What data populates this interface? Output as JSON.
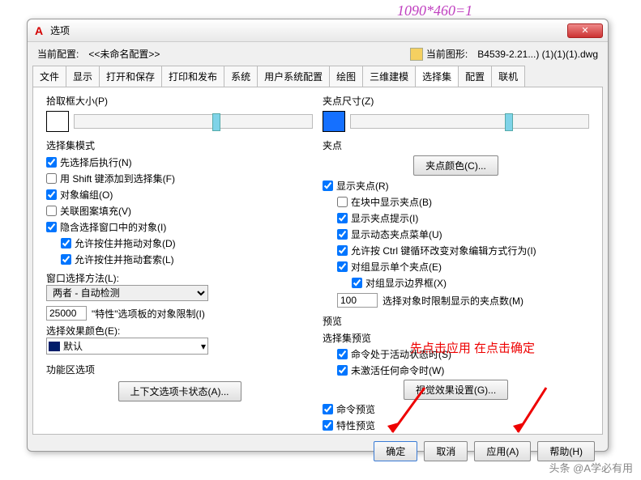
{
  "overlay": "1090*460=1",
  "dialog": {
    "title": "选项"
  },
  "profile": {
    "current_profile_label": "当前配置:",
    "current_profile_value": "<<未命名配置>>",
    "current_drawing_label": "当前图形:",
    "current_drawing_value": "B4539-2.21...) (1)(1)(1).dwg"
  },
  "tabs": [
    "文件",
    "显示",
    "打开和保存",
    "打印和发布",
    "系统",
    "用户系统配置",
    "绘图",
    "三维建模",
    "选择集",
    "配置",
    "联机"
  ],
  "active_tab": "选择集",
  "left": {
    "pickbox_label": "拾取框大小(P)",
    "mode_title": "选择集模式",
    "cb_noun_verb": "先选择后执行(N)",
    "cb_shift_add": "用 Shift 键添加到选择集(F)",
    "cb_object_group": "对象编组(O)",
    "cb_assoc_hatch": "关联图案填充(V)",
    "cb_implied_window": "隐含选择窗口中的对象(I)",
    "cb_allow_press_drag": "允许按住并拖动对象(D)",
    "cb_allow_press_drag_lasso": "允许按住并拖动套索(L)",
    "window_method_label": "窗口选择方法(L):",
    "window_method_value": "两者 - 自动检测",
    "limit_value": "25000",
    "limit_label": "\"特性\"选项板的对象限制(I)",
    "effect_color_label": "选择效果颜色(E):",
    "effect_color_value": "默认",
    "ribbon_title": "功能区选项",
    "ribbon_btn": "上下文选项卡状态(A)..."
  },
  "right": {
    "gripsize_label": "夹点尺寸(Z)",
    "grips_title": "夹点",
    "grip_color_btn": "夹点颜色(C)...",
    "cb_show_grips": "显示夹点(R)",
    "cb_grips_in_blocks": "在块中显示夹点(B)",
    "cb_grip_tips": "显示夹点提示(I)",
    "cb_dynamic_grip_menu": "显示动态夹点菜单(U)",
    "cb_ctrl_cycle": "允许按 Ctrl 键循环改变对象编辑方式行为(I)",
    "cb_group_single": "对组显示单个夹点(E)",
    "cb_group_bbox": "对组显示边界框(X)",
    "grip_limit_value": "100",
    "grip_limit_label": "选择对象时限制显示的夹点数(M)",
    "preview_title": "预览",
    "preview_sub": "选择集预览",
    "cb_active_cmd": "命令处于活动状态时(S)",
    "cb_no_active_cmd": "未激活任何命令时(W)",
    "visual_btn": "视觉效果设置(G)...",
    "cb_cmd_preview": "命令预览",
    "cb_prop_preview": "特性预览"
  },
  "note": "先点击应用 在点击确定",
  "buttons": {
    "ok": "确定",
    "cancel": "取消",
    "apply": "应用(A)",
    "help": "帮助(H)"
  },
  "footer": "头条 @A学必有用"
}
